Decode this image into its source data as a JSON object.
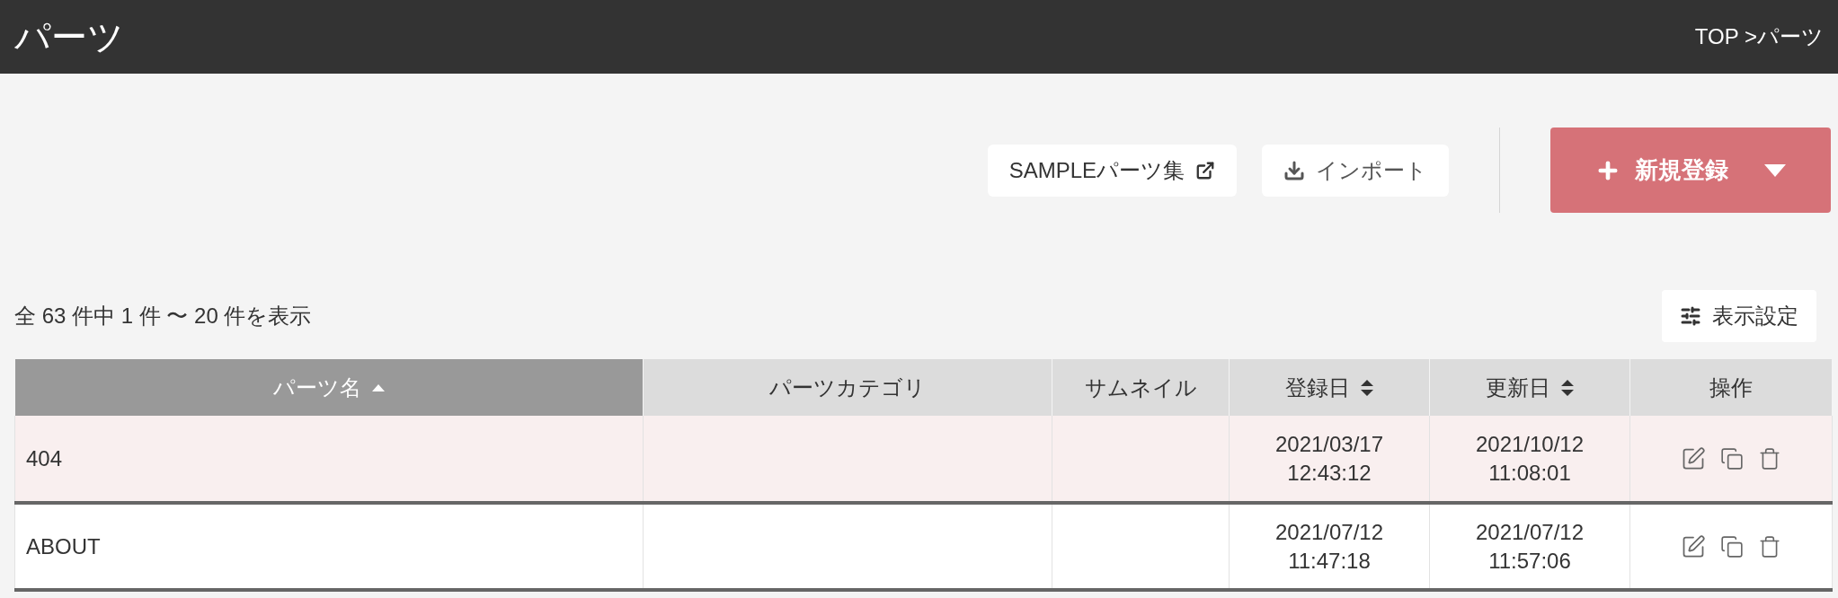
{
  "header": {
    "title": "パーツ",
    "breadcrumb": "TOP >パーツ"
  },
  "toolbar": {
    "buttons": [
      {
        "label": "SAMPLEパーツ集",
        "kind": "external"
      },
      {
        "label": "インポート",
        "kind": "import"
      }
    ],
    "primary_button": {
      "label": "新規登録"
    }
  },
  "result_count": "全 63 件中 1 件 〜 20 件を表示",
  "display_settings_button": "表示設定",
  "table": {
    "columns": [
      {
        "label": "パーツ名",
        "sortable": true,
        "sorted": true
      },
      {
        "label": "パーツカテゴリ",
        "sortable": false,
        "sorted": false
      },
      {
        "label": "サムネイル",
        "sortable": false,
        "sorted": false
      },
      {
        "label": "登録日",
        "sortable": true,
        "sorted": false
      },
      {
        "label": "更新日",
        "sortable": true,
        "sorted": false
      },
      {
        "label": "操作",
        "sortable": false,
        "sorted": false
      }
    ],
    "rows": [
      {
        "name": "404",
        "created": [
          "2021/03/17",
          "12:43:12"
        ],
        "updated": [
          "2021/10/12",
          "11:08:01"
        ]
      },
      {
        "name": "ABOUT",
        "created": [
          "2021/07/12",
          "11:47:18"
        ],
        "updated": [
          "2021/07/12",
          "11:57:06"
        ]
      }
    ]
  }
}
